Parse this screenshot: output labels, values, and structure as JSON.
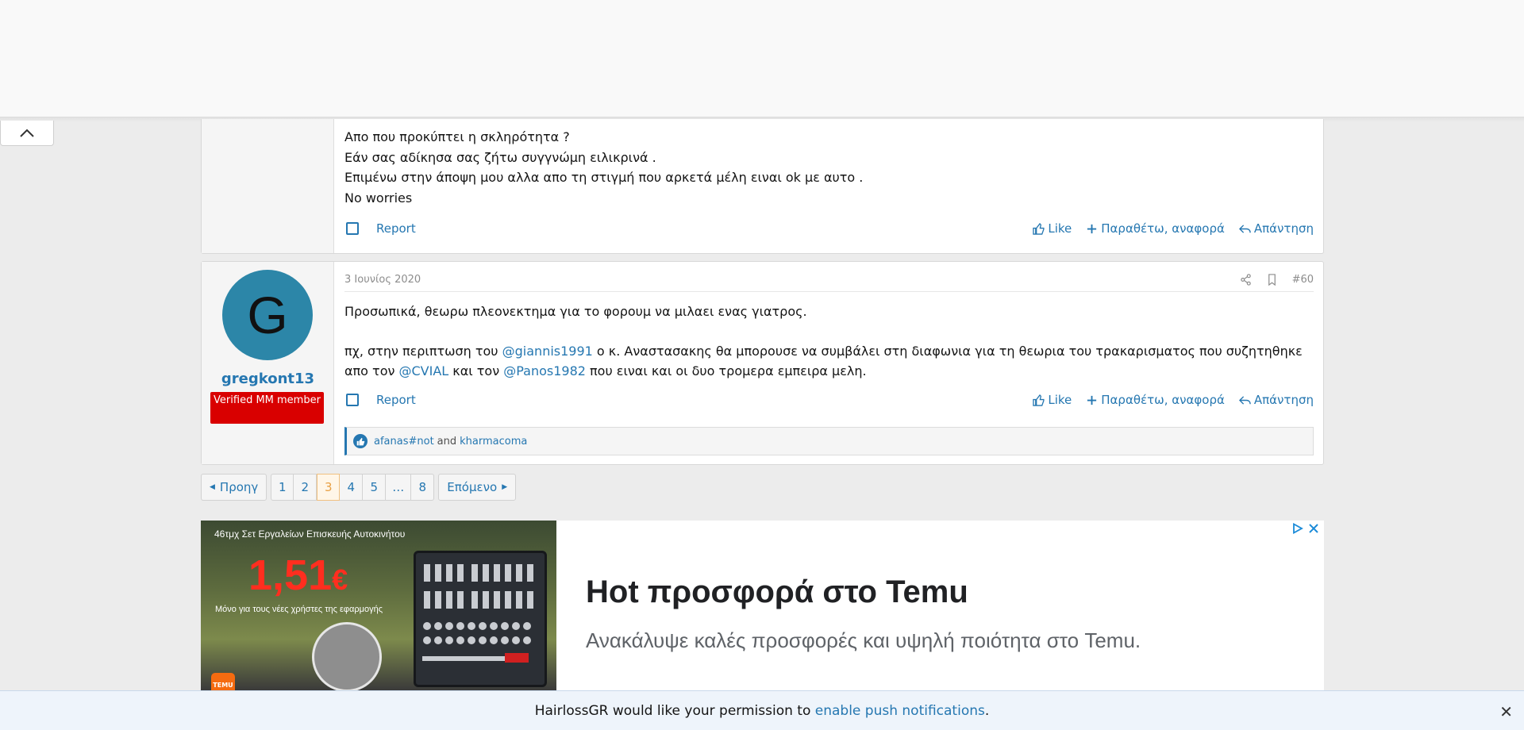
{
  "post1": {
    "lines": [
      "Απο που προκύπτει η σκληρότητα ?",
      "Εάν σας αδίκησα σας ζήτω συγγνώμη ειλικρινά .",
      "Επιμένω στην άποψη μου αλλα απο τη στιγμή που αρκετά μέλη ειναι ok με αυτο .",
      "No worries"
    ],
    "report": "Report",
    "like": "Like",
    "quote": "Παραθέτω, αναφορά",
    "reply": "Απάντηση"
  },
  "post2": {
    "avatar_letter": "G",
    "avatar_color": "#2c86a8",
    "username": "gregkont13",
    "badge": "Verified MM member",
    "badge_color": "#d90000",
    "date": "3 Ιουνίος 2020",
    "post_number": "#60",
    "para1": "Προσωπικά, θεωρω πλεονεκτημα για το φορουμ να μιλαει ενας γιατρος.",
    "para2_a": "πχ, στην περιπτωση του ",
    "mention1": "@giannis1991",
    "para2_b": " ο κ. Αναστασακης θα μπορουσε να συμβάλει στη διαφωνια για τη θεωρια του τρακαρισματος που συζητηθηκε απο τον ",
    "mention2": "@CVIAL",
    "para2_c": " και τον ",
    "mention3": "@Panos1982",
    "para2_d": " που ειναι και οι δυο τρομερα εμπειρα μελη.",
    "report": "Report",
    "like": "Like",
    "quote": "Παραθέτω, αναφορά",
    "reply": "Απάντηση",
    "reactions": {
      "user1": "afanas#not",
      "and": "and",
      "user2": "kharmacoma"
    }
  },
  "pagination": {
    "prev": "Προηγ",
    "pages": [
      "1",
      "2",
      "3",
      "4",
      "5",
      "…",
      "8"
    ],
    "current": "3",
    "next": "Επόμενο"
  },
  "ad": {
    "caption": "46τμχ Σετ Εργαλείων Επισκευής Αυτοκινήτου",
    "price": "1,51",
    "currency": "€",
    "sub": "Μόνο για τους νέες χρήστες της εφαρμογής",
    "title": "Hot προσφορά στο Temu",
    "description": "Ανακάλυψε καλές προσφορές και υψηλή ποιότητα στο Temu."
  },
  "push": {
    "text_before": "HairlossGR would like your permission to ",
    "link": "enable push notifications",
    "text_after": ".",
    "close": "✕"
  },
  "colors": {
    "accent": "#2577b1",
    "current_page": "#e8a044"
  },
  "icons": [
    "chevron-up-icon",
    "thumbs-up-icon",
    "plus-icon",
    "reply-icon",
    "share-icon",
    "bookmark-icon",
    "ad-choices-icon",
    "close-icon"
  ]
}
